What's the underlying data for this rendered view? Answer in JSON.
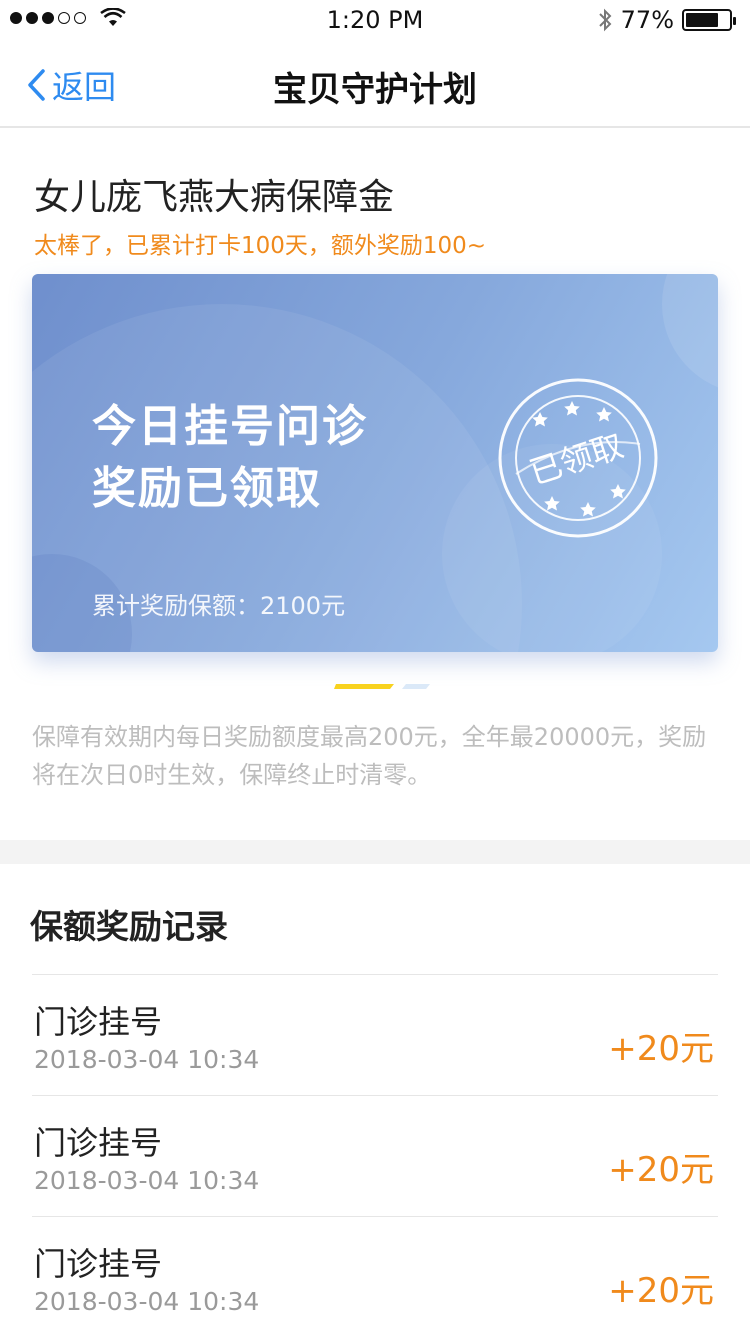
{
  "status_bar": {
    "time": "1:20 PM",
    "battery": "77%",
    "battery_level": 0.77
  },
  "nav": {
    "back_label": "返回",
    "title": "宝贝守护计划"
  },
  "plan": {
    "title": "女儿庞飞燕大病保障金",
    "subtitle": "太棒了，已累计打卡100天，额外奖励100~"
  },
  "card": {
    "line1": "今日挂号问诊",
    "line2": "奖励已领取",
    "total": "累计奖励保额：2100元",
    "stamp": "已领取"
  },
  "notice": "保障有效期内每日奖励额度最高200元，全年最20000元，奖励将在次日0时生效，保障终止时清零。",
  "records": {
    "title": "保额奖励记录",
    "items": [
      {
        "label": "门诊挂号",
        "time": "2018-03-04 10:34",
        "amount": "+20元"
      },
      {
        "label": "门诊挂号",
        "time": "2018-03-04 10:34",
        "amount": "+20元"
      },
      {
        "label": "门诊挂号",
        "time": "2018-03-04 10:34",
        "amount": "+20元"
      }
    ]
  },
  "colors": {
    "accent": "#2e8bf0",
    "orange": "#f08a1c",
    "card_start": "#6f8fcd",
    "card_end": "#a5c8f0"
  }
}
